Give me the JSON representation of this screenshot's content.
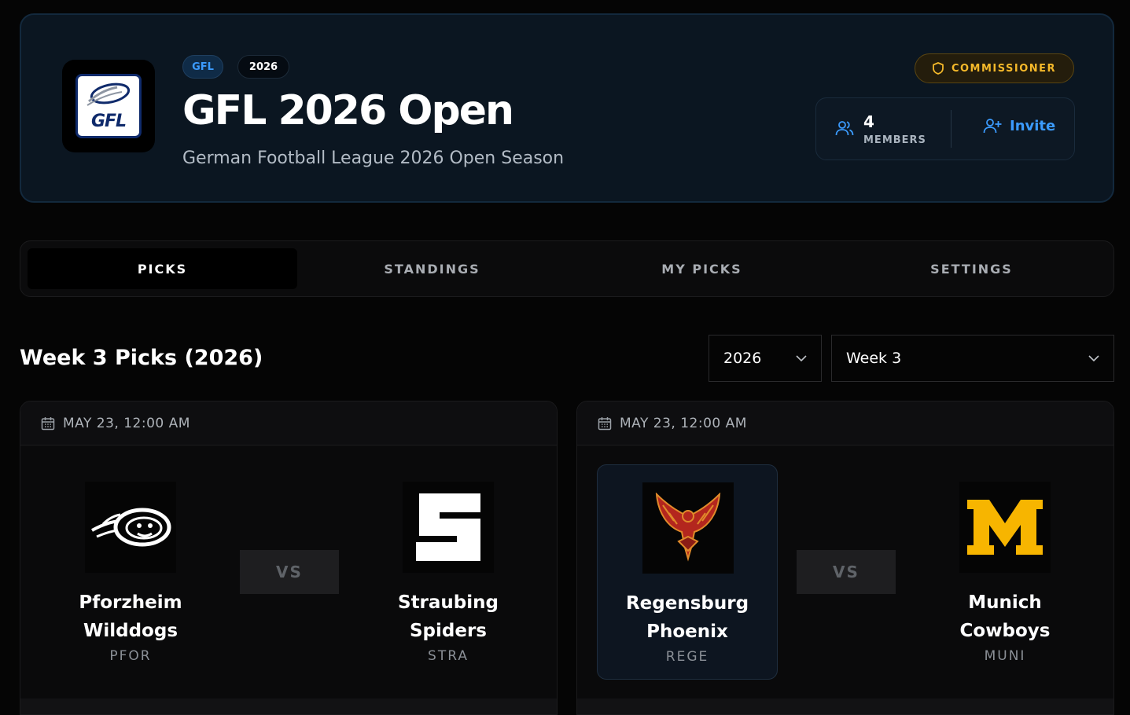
{
  "league": {
    "logo_text": "GFL",
    "tag": "GFL",
    "year": "2026",
    "title": "GFL 2026 Open",
    "subtitle": "German Football League 2026 Open Season",
    "role_badge": "COMMISSIONER",
    "members_count": "4",
    "members_label": "MEMBERS",
    "invite_label": "Invite"
  },
  "tabs": [
    {
      "label": "PICKS",
      "active": true
    },
    {
      "label": "STANDINGS",
      "active": false
    },
    {
      "label": "MY PICKS",
      "active": false
    },
    {
      "label": "SETTINGS",
      "active": false
    }
  ],
  "picks": {
    "heading": "Week 3 Picks (2026)",
    "year_select": "2026",
    "week_select": "Week 3",
    "vs_label": "VS"
  },
  "games": [
    {
      "datetime": "MAY 23, 12:00 AM",
      "home": {
        "name_line1": "Pforzheim",
        "name_line2": "Wilddogs",
        "abbr": "PFOR",
        "logo_icon": "bulldog-logo-icon",
        "selected": false
      },
      "away": {
        "name_line1": "Straubing",
        "name_line2": "Spiders",
        "abbr": "STRA",
        "logo_icon": "letter-s-logo-icon",
        "selected": false
      }
    },
    {
      "datetime": "MAY 23, 12:00 AM",
      "home": {
        "name_line1": "Regensburg",
        "name_line2": "Phoenix",
        "abbr": "REGE",
        "logo_icon": "phoenix-logo-icon",
        "selected": true
      },
      "away": {
        "name_line1": "Munich",
        "name_line2": "Cowboys",
        "abbr": "MUNI",
        "logo_icon": "letter-m-logo-icon",
        "selected": false
      }
    }
  ],
  "colors": {
    "accent_blue": "#3b9bff",
    "commissioner_gold": "#f5b92a",
    "munich_yellow": "#f7b500",
    "phoenix_red": "#b3261e"
  }
}
